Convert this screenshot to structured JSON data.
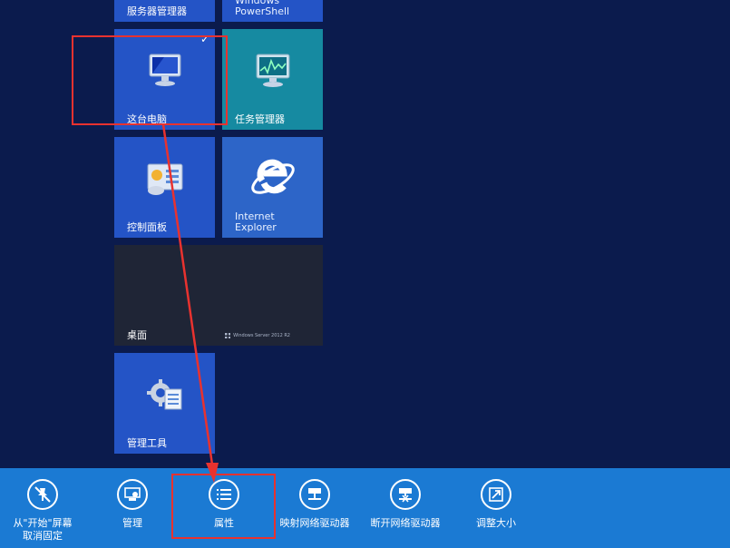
{
  "tiles": {
    "server_manager": {
      "label": "服务器管理器"
    },
    "powershell": {
      "label": "Windows\nPowerShell"
    },
    "this_pc": {
      "label": "这台电脑"
    },
    "task_manager": {
      "label": "任务管理器"
    },
    "control_panel": {
      "label": "控制面板"
    },
    "internet_explorer": {
      "label": "Internet\nExplorer"
    },
    "desktop": {
      "label": "桌面",
      "brand": "Windows Server 2012 R2"
    },
    "admin_tools": {
      "label": "管理工具"
    }
  },
  "appbar": {
    "unpin": "从\"开始\"屏幕\n取消固定",
    "manage": "管理",
    "properties": "属性",
    "map_drive": "映射网络驱动器",
    "disconnect_drive": "断开网络驱动器",
    "resize": "调整大小"
  },
  "colors": {
    "background": "#0b1b4d",
    "appbar": "#1b7ad3",
    "tile_blue": "#2454c6",
    "tile_teal": "#168aa1",
    "annotation_red": "#e8322f"
  }
}
